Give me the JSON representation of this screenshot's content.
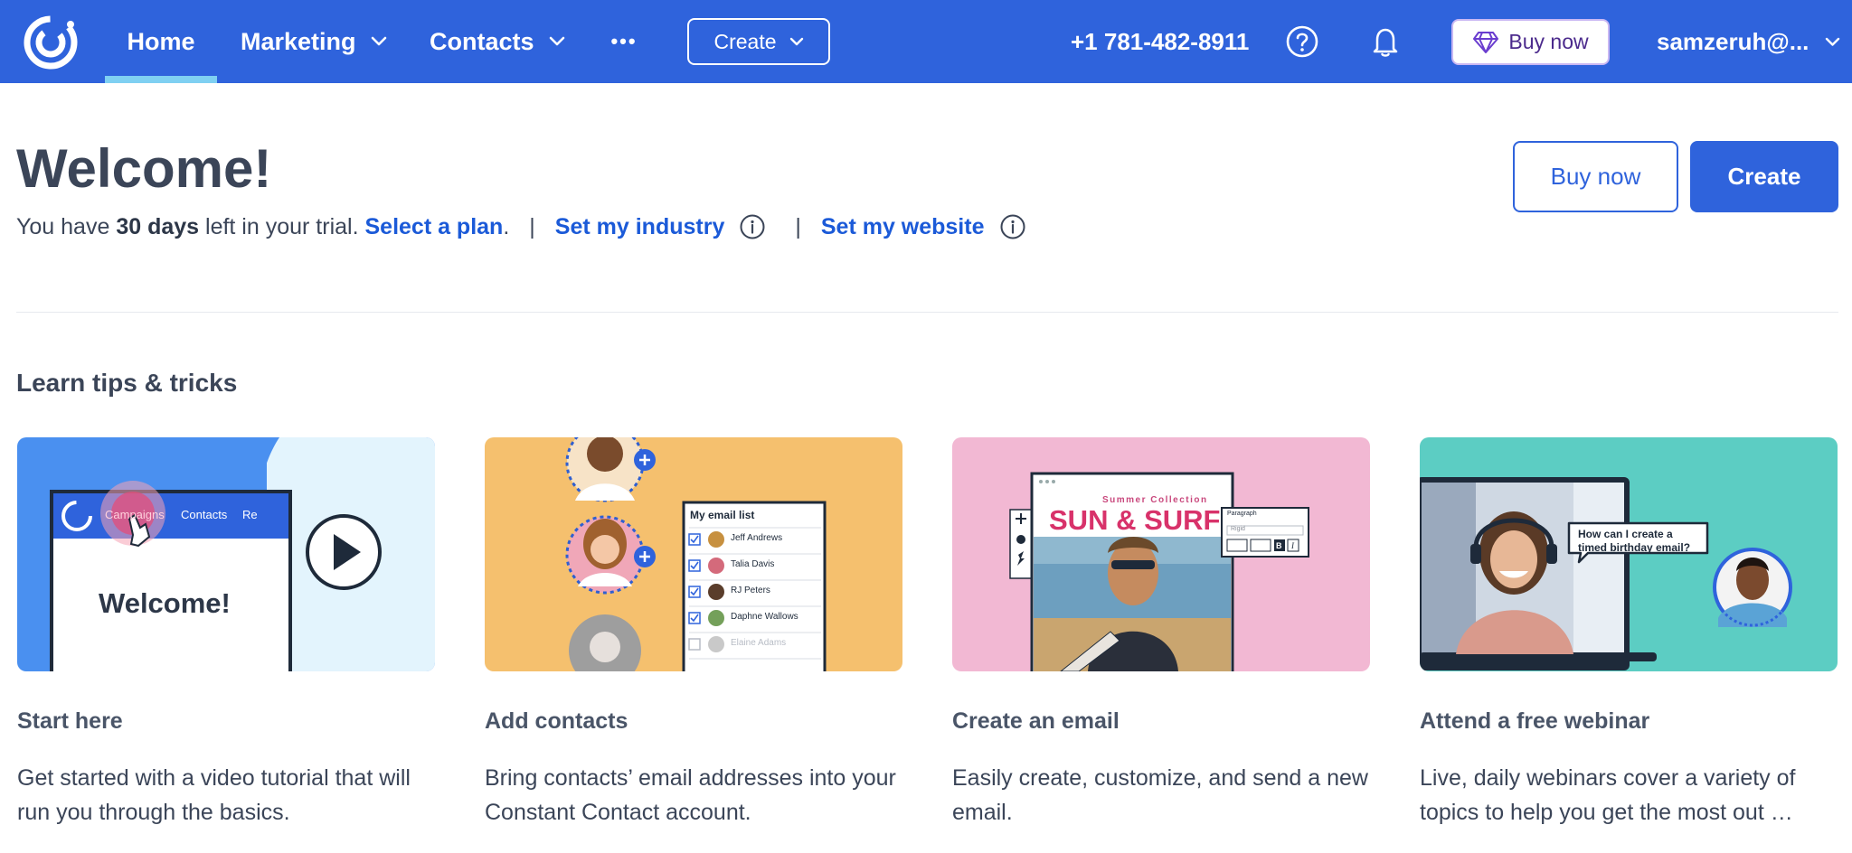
{
  "nav": {
    "home": "Home",
    "marketing": "Marketing",
    "contacts": "Contacts",
    "more": "•••",
    "create": "Create",
    "phone": "+1 781-482-8911",
    "buy_now": "Buy now",
    "user": "samzeruh@..."
  },
  "header": {
    "title": "Welcome!",
    "trial_prefix": "You have",
    "trial_days": "30 days",
    "trial_suffix": "left in your trial.",
    "select_plan": "Select a plan",
    "period": ".",
    "separator": "|",
    "set_industry": "Set my industry",
    "set_website": "Set my website",
    "buy_now": "Buy now",
    "create": "Create"
  },
  "tips": {
    "section_title": "Learn tips & tricks",
    "cards": [
      {
        "title": "Start here",
        "description": "Get started with a video tutorial that will run you through the basics.",
        "thumb": {
          "tab_campaigns": "Campaigns",
          "tab_contacts": "Contacts",
          "tab_partial": "Re",
          "welcome": "Welcome!"
        }
      },
      {
        "title": "Add contacts",
        "description": "Bring contacts’ email addresses into your Constant Contact account.",
        "thumb": {
          "list_title": "My email list",
          "names": [
            "Jeff Andrews",
            "Talia Davis",
            "RJ Peters",
            "Daphne Wallows",
            "Elaine Adams"
          ]
        }
      },
      {
        "title": "Create an email",
        "description": "Easily create, customize, and send a new email.",
        "thumb": {
          "kicker": "Summer Collection",
          "headline": "SUN & SURF",
          "panel_label": "Paragraph",
          "panel_value": "Rigid"
        }
      },
      {
        "title": "Attend a free webinar",
        "description": "Live, daily webinars cover a variety of topics to help you get the most out …",
        "thumb": {
          "bubble": "How can I create a timed birthday email?"
        }
      }
    ]
  },
  "colors": {
    "nav_bg": "#2f63dc",
    "link": "#1b5ad8",
    "home_underline": "#7fd0f2",
    "card1_bg": "#4a90f0",
    "card2_bg": "#f5c06e",
    "card3_bg": "#f2b8d3",
    "card4_bg": "#5ccdc3"
  }
}
